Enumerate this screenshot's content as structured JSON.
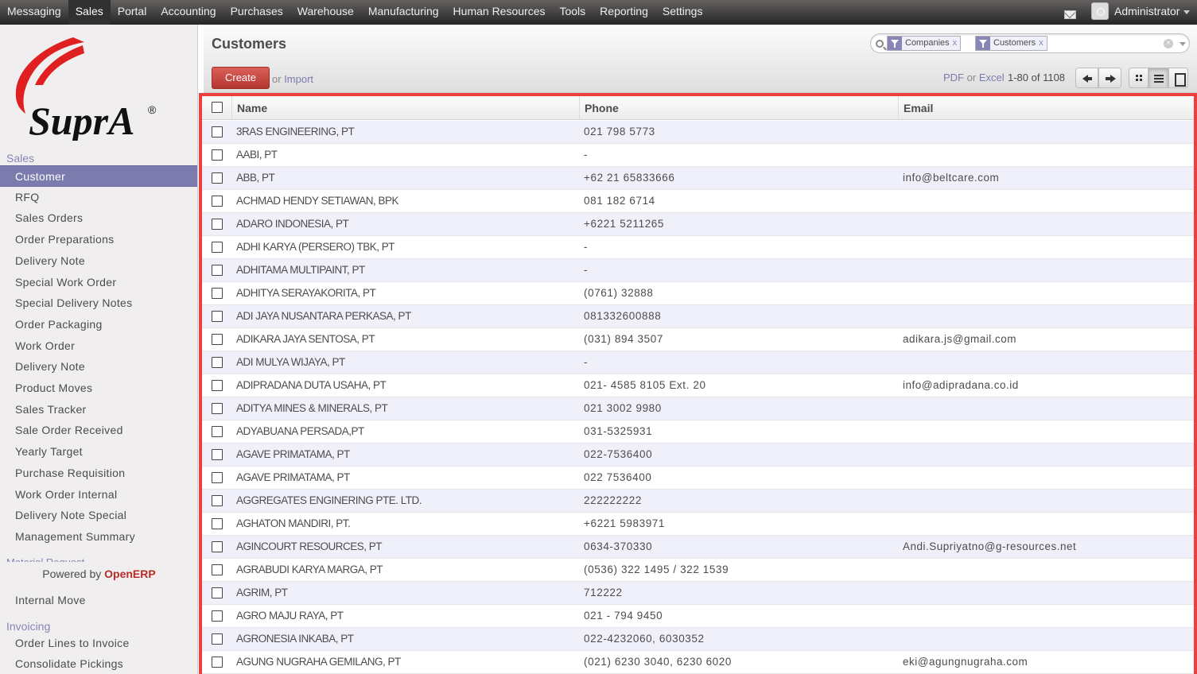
{
  "topbar": {
    "menus": [
      "Messaging",
      "Sales",
      "Portal",
      "Accounting",
      "Purchases",
      "Warehouse",
      "Manufacturing",
      "Human Resources",
      "Tools",
      "Reporting",
      "Settings"
    ],
    "active_menu": "Sales",
    "user_name": "Administrator",
    "icons": [
      "mail-icon",
      "avatar-icon"
    ]
  },
  "sidebar": {
    "logo_text": "SuprA",
    "logo_mark": "®",
    "sections": {
      "sales": "Sales",
      "material_request": "Material Request",
      "invoicing": "Invoicing"
    },
    "sales_items": [
      "Customer",
      "RFQ",
      "Sales Orders",
      "Order Preparations",
      "Delivery Note",
      "Special Work Order",
      "Special Delivery Notes",
      "Order Packaging",
      "Work Order",
      "Delivery Note",
      "Product Moves",
      "Sales Tracker",
      "Sale Order Received",
      "Yearly Target",
      "Purchase Requisition",
      "Work Order Internal",
      "Delivery Note Special",
      "Management Summary"
    ],
    "active_item": "Customer",
    "material_items": [
      "Internal Move"
    ],
    "invoicing_items": [
      "Order Lines to Invoice",
      "Consolidate Pickings"
    ],
    "powered_by": "Powered by",
    "powered_brand": "OpenERP"
  },
  "header": {
    "title": "Customers",
    "search_facets": [
      "Companies",
      "Customers"
    ],
    "facet_remove": "x",
    "create_label": "Create",
    "or_label": "or",
    "import_label": "Import",
    "export_pdf": "PDF",
    "export_or": "or",
    "export_excel": "Excel",
    "pager": "1-80 of 1108"
  },
  "table": {
    "columns": [
      "Name",
      "Phone",
      "Email"
    ],
    "rows": [
      {
        "name": "3RAS ENGINEERING, PT",
        "phone": "021 798 5773",
        "email": ""
      },
      {
        "name": "AABI, PT",
        "phone": "-",
        "email": ""
      },
      {
        "name": "ABB, PT",
        "phone": "+62 21 65833666",
        "email": "info@beltcare.com"
      },
      {
        "name": "ACHMAD HENDY SETIAWAN, BPK",
        "phone": "081 182 6714",
        "email": ""
      },
      {
        "name": "ADARO INDONESIA, PT",
        "phone": "+6221 5211265",
        "email": ""
      },
      {
        "name": "ADHI KARYA (PERSERO) TBK, PT",
        "phone": "-",
        "email": ""
      },
      {
        "name": "ADHITAMA MULTIPAINT, PT",
        "phone": "-",
        "email": ""
      },
      {
        "name": "ADHITYA SERAYAKORITA, PT",
        "phone": "(0761) 32888",
        "email": ""
      },
      {
        "name": "ADI JAYA NUSANTARA PERKASA, PT",
        "phone": "081332600888",
        "email": ""
      },
      {
        "name": "ADIKARA JAYA SENTOSA, PT",
        "phone": "(031) 894 3507",
        "email": "adikara.js@gmail.com"
      },
      {
        "name": "ADI MULYA WIJAYA, PT",
        "phone": "-",
        "email": ""
      },
      {
        "name": "ADIPRADANA DUTA USAHA, PT",
        "phone": "021- 4585 8105 Ext. 20",
        "email": "info@adipradana.co.id"
      },
      {
        "name": "ADITYA MINES & MINERALS, PT",
        "phone": "021 3002 9980",
        "email": ""
      },
      {
        "name": "ADYABUANA PERSADA,PT",
        "phone": "031-5325931",
        "email": ""
      },
      {
        "name": "AGAVE PRIMATAMA, PT",
        "phone": "022-7536400",
        "email": ""
      },
      {
        "name": "AGAVE PRIMATAMA, PT",
        "phone": "022 7536400",
        "email": ""
      },
      {
        "name": "AGGREGATES ENGINERING PTE. LTD.",
        "phone": "222222222",
        "email": ""
      },
      {
        "name": "AGHATON MANDIRI, PT.",
        "phone": "+6221 5983971",
        "email": ""
      },
      {
        "name": "AGINCOURT RESOURCES, PT",
        "phone": "0634-370330",
        "email": "Andi.Supriyatno@g-resources.net"
      },
      {
        "name": "AGRABUDI KARYA MARGA, PT",
        "phone": "(0536) 322 1495 / 322 1539",
        "email": ""
      },
      {
        "name": "AGRIM, PT",
        "phone": "712222",
        "email": ""
      },
      {
        "name": "AGRO MAJU RAYA, PT",
        "phone": "021 - 794 9450",
        "email": ""
      },
      {
        "name": "AGRONESIA INKABA, PT",
        "phone": "022-4232060, 6030352",
        "email": ""
      },
      {
        "name": "AGUNG NUGRAHA GEMILANG, PT",
        "phone": "(021) 6230 3040, 6230 6020",
        "email": "eki@agungnugraha.com"
      }
    ]
  },
  "colors": {
    "accent": "#7c7bad",
    "create_button": "#c9443e",
    "highlight_border": "#ee3f3f",
    "topbar": "#3a3838"
  }
}
